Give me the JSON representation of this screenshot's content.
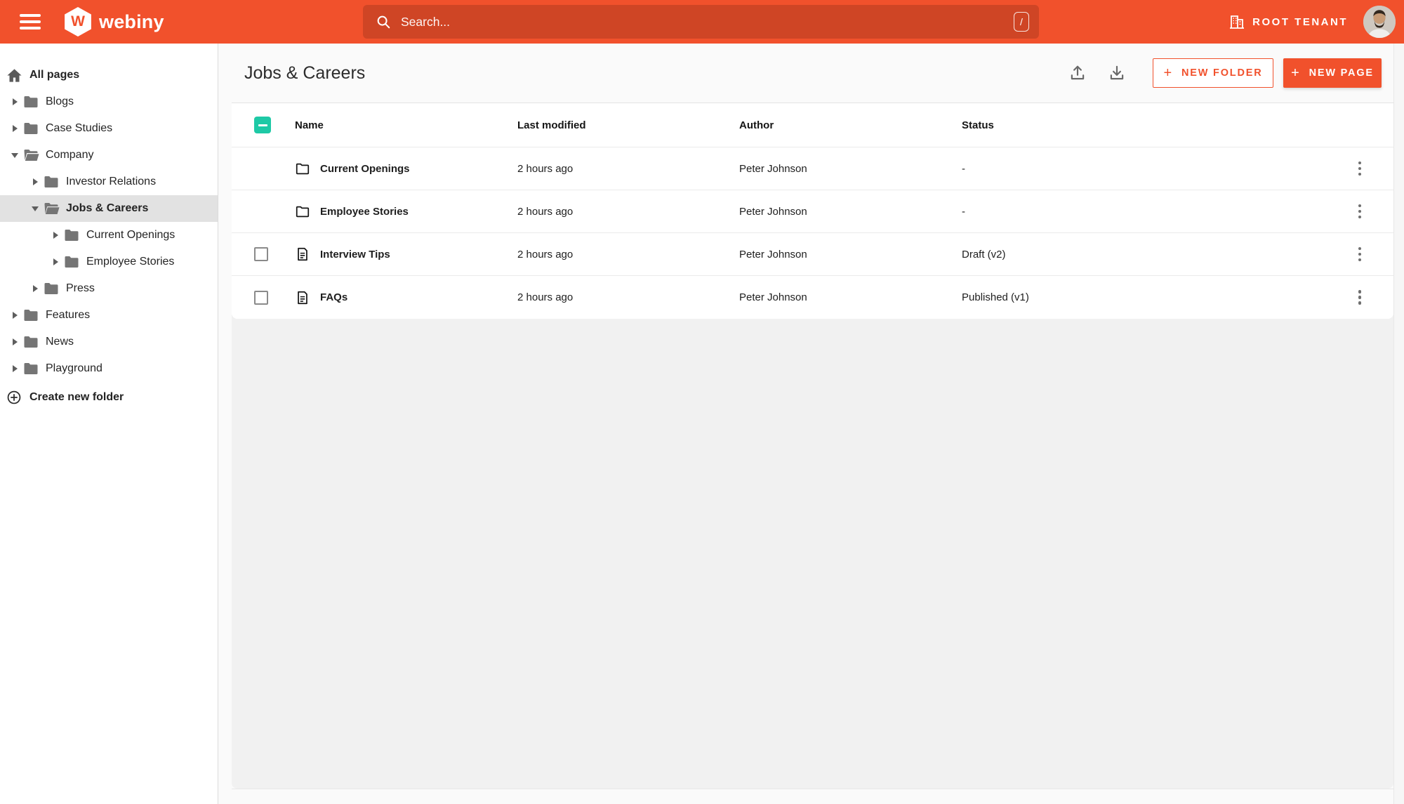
{
  "topbar": {
    "brand": "webiny",
    "search": {
      "placeholder": "Search...",
      "shortcut": "/"
    },
    "tenant": {
      "label": "ROOT TENANT"
    }
  },
  "sidebar": {
    "items": [
      {
        "label": "All pages"
      },
      {
        "label": "Blogs"
      },
      {
        "label": "Case Studies"
      },
      {
        "label": "Company"
      },
      {
        "label": "Investor Relations"
      },
      {
        "label": "Jobs & Careers"
      },
      {
        "label": "Current Openings"
      },
      {
        "label": "Employee Stories"
      },
      {
        "label": "Press"
      },
      {
        "label": "Features"
      },
      {
        "label": "News"
      },
      {
        "label": "Playground"
      }
    ],
    "create_folder": {
      "label": "Create new folder"
    }
  },
  "main": {
    "title": "Jobs & Careers",
    "actions": {
      "new_folder": "NEW FOLDER",
      "new_page": "NEW PAGE",
      "plus": "+"
    },
    "table": {
      "columns": {
        "name": "Name",
        "modified": "Last modified",
        "author": "Author",
        "status": "Status"
      },
      "rows": [
        {
          "name": "Current Openings",
          "type": "folder",
          "modified": "2 hours ago",
          "author": "Peter Johnson",
          "status": "-"
        },
        {
          "name": "Employee Stories",
          "type": "folder",
          "modified": "2 hours ago",
          "author": "Peter Johnson",
          "status": "-"
        },
        {
          "name": "Interview Tips",
          "type": "page",
          "modified": "2 hours ago",
          "author": "Peter Johnson",
          "status": "Draft (v2)"
        },
        {
          "name": "FAQs",
          "type": "page",
          "modified": "2 hours ago",
          "author": "Peter Johnson",
          "status": "Published (v1)"
        }
      ]
    }
  },
  "colors": {
    "accent_orange": "#f1512c",
    "search_bg_overlay": "rgba(0,0,0,0.14)",
    "checkbox_teal": "#1ec9a6",
    "selected_item_bg": "#e2e2e2"
  }
}
